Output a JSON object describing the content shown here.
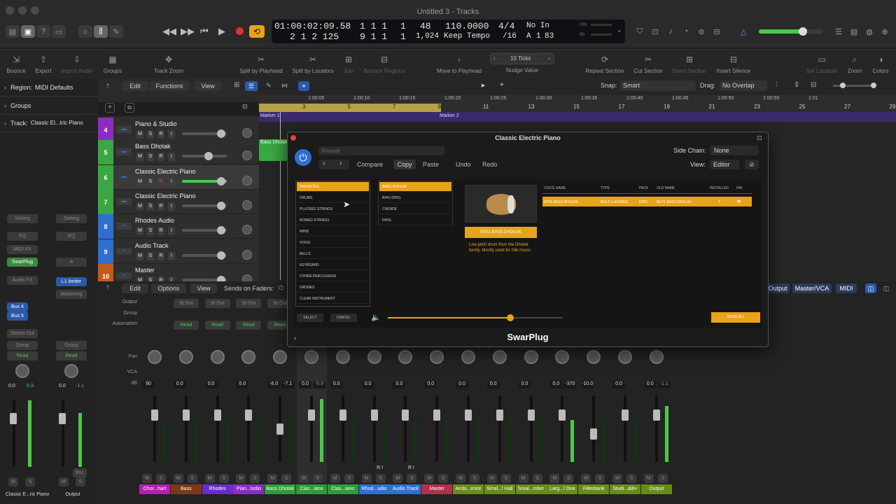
{
  "window": {
    "title": "Untitled 3 - Tracks"
  },
  "lcd": {
    "time": "01:00:02:09.58",
    "bars": "1  1  1",
    "bars_sub": "1",
    "bars2": "2  1  2  125",
    "bars3": "9  1  1",
    "bars3_sub": "1",
    "tempo_top": "48",
    "tempo_bottom": "1,024",
    "bpm": "110.0000",
    "tempo_mode": "Keep Tempo",
    "sig": "4/4",
    "div": "/16",
    "in_label": "No In",
    "key": "A",
    "key_num": "1",
    "key_val": "83",
    "cpu": "CPU",
    "hd": "HD"
  },
  "toolbar": {
    "bounce": "Bounce",
    "export": "Export",
    "import_audio": "Import Audio",
    "groups": "Groups",
    "track_zoom": "Track Zoom",
    "split_playhead": "Split by Playhead",
    "split_locators": "Split by Locators",
    "join": "Join",
    "bounce_regions": "Bounce Regions",
    "move_playhead": "Move to Playhead",
    "nudge_value": "Nudge Value",
    "nudge_ticks": "10 Ticks",
    "repeat_section": "Repeat Section",
    "cut_section": "Cut Section",
    "insert_section": "Insert Section",
    "insert_silence": "Insert Silence",
    "set_locators": "Set Locators",
    "zoom": "Zoom",
    "colors": "Colors"
  },
  "inspector": {
    "region": "Region:",
    "region_val": "MIDI Defaults",
    "groups": "Groups",
    "track": "Track:",
    "track_val": "Classic El...tric Piano",
    "setting": "Setting",
    "eq": "EQ",
    "midi_fx": "MIDI FX",
    "swarplug": "SwarPlug",
    "audio_fx": "Audio FX",
    "l1limiter": "L1 limiter",
    "mastering": "Mastering",
    "bus4": "Bus 4",
    "bus5": "Bus 5",
    "stereo_out": "Stereo Out",
    "group": "Group",
    "read": "Read",
    "left_db1": "0.0",
    "left_db2": "-5.9",
    "right_db1": "0.0",
    "right_db2": "-1.1",
    "bnc": "Bnc",
    "m": "M",
    "s": "S",
    "left_name": "Classic E...ric Piano",
    "right_name": "Output"
  },
  "arrange_menu": {
    "edit": "Edit",
    "functions": "Functions",
    "view": "View",
    "snap": "Snap:",
    "snap_val": "Smart",
    "drag": "Drag:",
    "drag_val": "No Overlap"
  },
  "ruler": {
    "times": [
      "1:00:05",
      "1:00:10",
      "1:00:15",
      "1:00:20",
      "1:00:25",
      "1:00:30",
      "1:00:35",
      "1:00:40",
      "1:00:45",
      "1:00:50",
      "1:00:55",
      "1:01"
    ],
    "bars": [
      "3",
      "5",
      "7",
      "9",
      "11",
      "13",
      "15",
      "17",
      "19",
      "21",
      "23",
      "25",
      "27",
      "29"
    ],
    "marker1": "Marker 1",
    "marker2": "Marker 2"
  },
  "tracks": [
    {
      "num": "4",
      "name": "Piano & Studio",
      "color": "#8a2ec0"
    },
    {
      "num": "5",
      "name": "Bass Dholak",
      "color": "#3aa842"
    },
    {
      "num": "6",
      "name": "Classic Electric Piano",
      "color": "#3aa842"
    },
    {
      "num": "7",
      "name": "Classic Electric Piano",
      "color": "#3aa842"
    },
    {
      "num": "8",
      "name": "Rhodes Audio",
      "color": "#2f6fd0"
    },
    {
      "num": "9",
      "name": "Audio Track",
      "color": "#2f6fd0"
    },
    {
      "num": "10",
      "name": "Master",
      "color": "#c25a1a"
    }
  ],
  "track_btn": {
    "m": "M",
    "s": "S",
    "r": "R",
    "i": "I"
  },
  "mixer_menu": {
    "edit": "Edit",
    "options": "Options",
    "view": "View",
    "sends": "Sends on Faders:",
    "output": "Output",
    "master_vca": "Master/VCA",
    "midi": "MIDI"
  },
  "mixer_labels": {
    "output": "Output",
    "group": "Group",
    "automation": "Automation",
    "pan": "Pan",
    "vca": "VCA",
    "db": "dB"
  },
  "strips": [
    {
      "name": "Chor...hart",
      "color": "#b21fb2",
      "output": "",
      "auto": "",
      "db1": "90",
      "db2": "",
      "ri": ""
    },
    {
      "name": "Bass",
      "color": "#7a3a1a",
      "output": "St Out",
      "auto": "Read",
      "db1": "0.0",
      "db2": "",
      "ri": ""
    },
    {
      "name": "Rhodes",
      "color": "#6b2bd0",
      "output": "St Out",
      "auto": "Read",
      "db1": "0.0",
      "db2": "",
      "ri": ""
    },
    {
      "name": "Pian...tudio",
      "color": "#8a2ec0",
      "output": "St Out",
      "auto": "Read",
      "db1": "0.0",
      "db2": "",
      "ri": ""
    },
    {
      "name": "Bass Dholak",
      "color": "#2f9a3a",
      "output": "St Out",
      "auto": "Read",
      "db1": "-6.0",
      "db2": "-7.1",
      "ri": ""
    },
    {
      "name": "Clas...iano",
      "color": "#2f9a3a",
      "output": "",
      "auto": "",
      "db1": "0.0",
      "db2": "-5.9",
      "ri": ""
    },
    {
      "name": "Clas...iano",
      "color": "#2f9a3a",
      "output": "",
      "auto": "",
      "db1": "0.0",
      "db2": "",
      "ri": ""
    },
    {
      "name": "Rhod...udio",
      "color": "#2f6fd0",
      "output": "",
      "auto": "",
      "db1": "0.0",
      "db2": "",
      "ri": "R I"
    },
    {
      "name": "Audio Track",
      "color": "#2f6fd0",
      "output": "",
      "auto": "",
      "db1": "0.0",
      "db2": "",
      "ri": "R I"
    },
    {
      "name": "Master",
      "color": "#b03050",
      "output": "",
      "auto": "",
      "db1": "0.0",
      "db2": "",
      "ri": ""
    },
    {
      "name": "Ambi...ence",
      "color": "#6a8a1a",
      "output": "",
      "auto": "",
      "db1": "0.0",
      "db2": "",
      "ri": ""
    },
    {
      "name": "Smal...l Hall",
      "color": "#6a8a1a",
      "output": "",
      "auto": "",
      "db1": "0.0",
      "db2": "",
      "ri": ""
    },
    {
      "name": "Smal...mber",
      "color": "#6a8a1a",
      "output": "",
      "auto": "",
      "db1": "0.0",
      "db2": "",
      "ri": ""
    },
    {
      "name": "Larg...l One",
      "color": "#6a8a1a",
      "output": "",
      "auto": "",
      "db1": "0.0",
      "db2": "-370",
      "ri": ""
    },
    {
      "name": "Filterbank",
      "color": "#6a8a1a",
      "output": "",
      "auto": "",
      "db1": "-10.0",
      "db2": "",
      "ri": ""
    },
    {
      "name": "Studi...&B+",
      "color": "#6a8a1a",
      "output": "",
      "auto": "",
      "db1": "0.0",
      "db2": "",
      "ri": ""
    },
    {
      "name": "Output",
      "color": "#6a8a1a",
      "output": "",
      "auto": "",
      "db1": "0.0",
      "db2": "-1.1",
      "ri": ""
    }
  ],
  "plugin": {
    "title": "Classic Electric Piano",
    "preset": "Manual",
    "compare": "Compare",
    "copy": "Copy",
    "paste": "Paste",
    "undo": "Undo",
    "redo": "Redo",
    "side_chain": "Side Chain:",
    "side_chain_val": "None",
    "view": "View:",
    "view_val": "Editor",
    "categories": [
      "FAVORITES",
      "DRUMS",
      "PLUCKED STRINGS",
      "BOWED STRINGS",
      "WIND",
      "VOICE",
      "BELLS",
      "KEYBOARD",
      "OTHER PERCUSSION",
      "DRONES",
      "CLEAR INSTRUMENT"
    ],
    "subcategories": [
      "BASS DHOLAK",
      "BIHU DHOL",
      "CHENDE",
      "DHOL"
    ],
    "instrument_name": "EP01 BASS DHOLAK",
    "description": "Low pitch drum from the Dholak family. Mostly used for folk music.",
    "columns": [
      "VOICE NAME",
      "TYPE",
      "PACK",
      "OLD NAME",
      "INSTALLED",
      "FAV"
    ],
    "row": [
      "EP01 BASS DHOLAK",
      "MULTI-LAYERED",
      "EP01",
      "MLP1 BASS DHOLAK",
      "Y",
      "★"
    ],
    "select": "SELECT",
    "cancel": "CANCEL",
    "show_all": "SHOW ALL",
    "volume": 0.35,
    "footer": "SwarPlug"
  }
}
